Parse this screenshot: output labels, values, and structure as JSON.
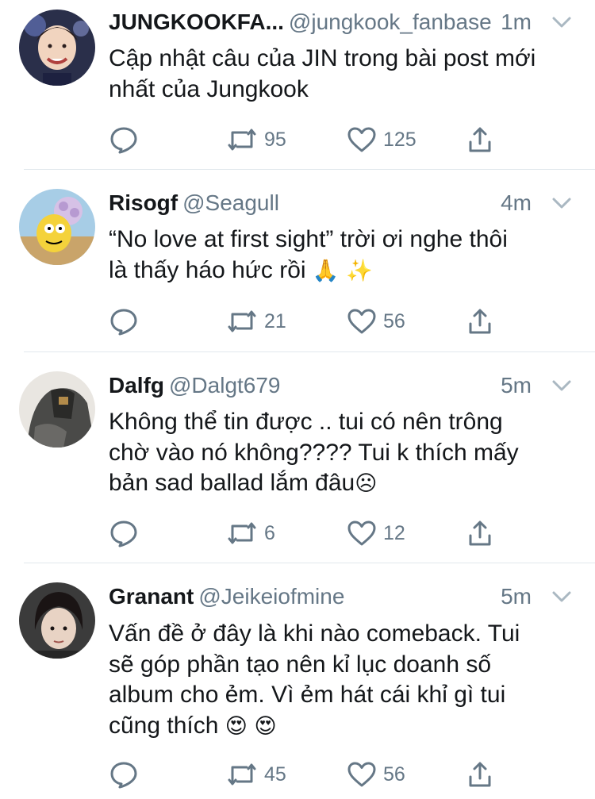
{
  "tweets": [
    {
      "name": "JUNGKOOKFA...",
      "handle": "@jungkook_fanbase",
      "time": "1m",
      "lines": [
        "Cập nhật câu của JIN trong bài post mới",
        "nhất của Jungkook"
      ],
      "emoji_line": "",
      "retweets": "95",
      "likes": "125"
    },
    {
      "name": "Risogf",
      "handle": "@Seagull",
      "time": "4m",
      "lines": [
        "“No love at first sight” trời ơi nghe thôi"
      ],
      "emoji_line": "là thấy háo hức rồi ",
      "emojis": "🙏 ✨",
      "retweets": "21",
      "likes": "56"
    },
    {
      "name": "Dalfg",
      "handle": "@Dalgt679",
      "time": "5m",
      "lines": [
        "Không thể tin được .. tui có nên trông",
        "chờ vào nó không???? Tui k thích mấy"
      ],
      "emoji_line": "bản sad ballad lắm đâu",
      "emojis": "☹",
      "retweets": "6",
      "likes": "12"
    },
    {
      "name": "Granant",
      "handle": "@Jeikeiofmine",
      "time": "5m",
      "lines": [
        "Vấn đề ở đây là khi nào comeback. Tui",
        "sẽ góp phần tạo nên kỉ lục doanh số",
        "album cho ẻm. Vì ẻm hát cái khỉ gì tui"
      ],
      "emoji_line": "cũng thích ",
      "emojis": "😍 😍",
      "retweets": "45",
      "likes": "56"
    }
  ],
  "icons": {
    "reply": "reply-icon",
    "retweet": "retweet-icon",
    "like": "heart-icon",
    "share": "share-icon",
    "caret": "chevron-down-icon"
  },
  "colors": {
    "text": "#14171a",
    "secondary": "#657786",
    "divider": "#e1e8ed"
  }
}
